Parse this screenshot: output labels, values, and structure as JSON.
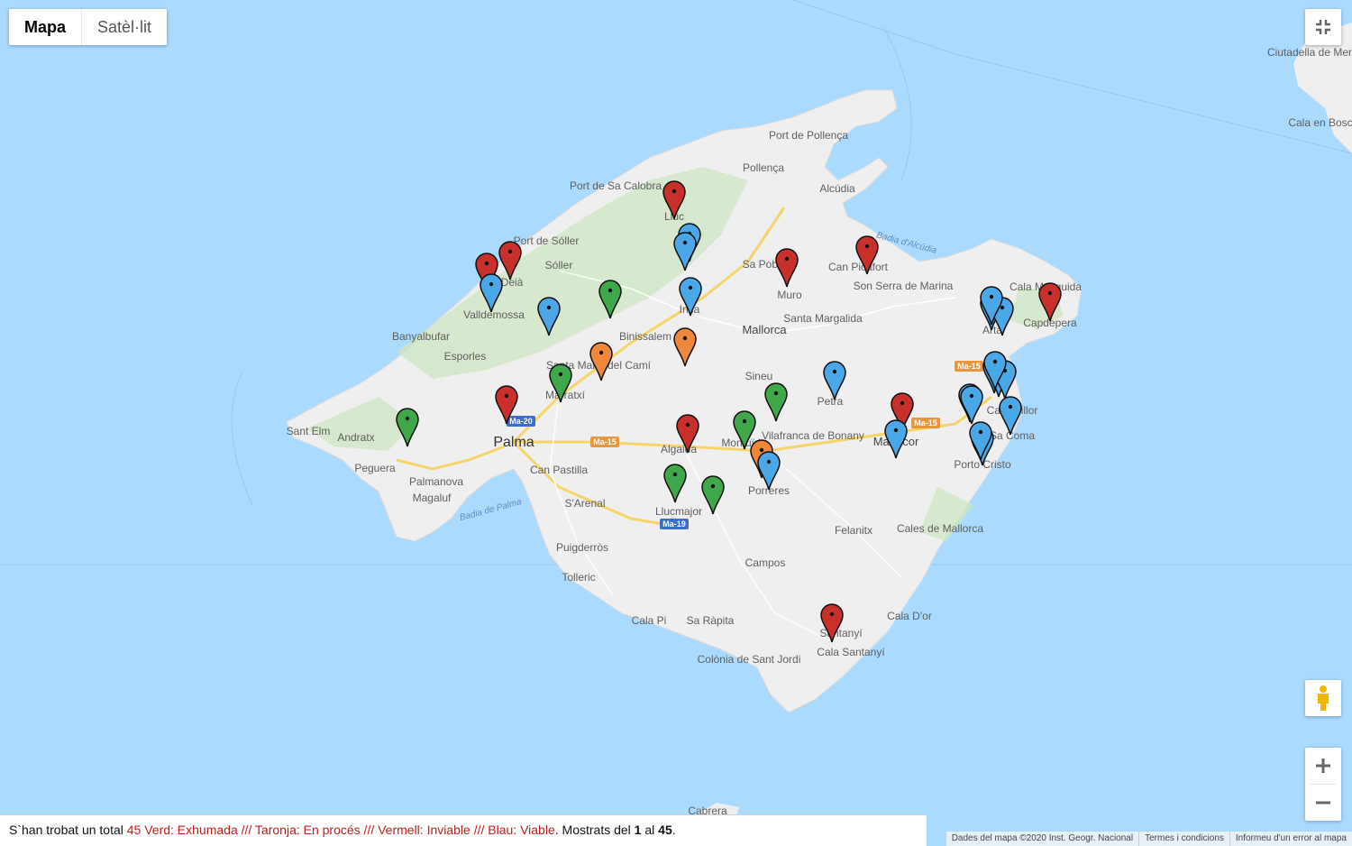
{
  "map_type": {
    "map_label": "Mapa",
    "satellite_label": "Satèl·lit"
  },
  "places": {
    "palma": "Palma",
    "mallorca": "Mallorca",
    "manacor": "Manacor",
    "port_de_pollenca": "Port de Pollença",
    "pollenca": "Pollença",
    "alcudia": "Alcúdia",
    "badia_alcudia": "Badia d'Alcúdia",
    "port_de_sa_calobra": "Port de Sa Calobra",
    "lluc": "Lluc",
    "port_de_soller": "Port de Sóller",
    "soller": "Sóller",
    "deia": "Deià",
    "valldemossa": "Valldemossa",
    "banyalbufar": "Banyalbufar",
    "esporles": "Esporles",
    "sant_elm": "Sant Elm",
    "andratx": "Andratx",
    "peguera": "Peguera",
    "palmanova": "Palmanova",
    "magaluf": "Magaluf",
    "badia_palma": "Badia de Palma",
    "can_pastilla": "Can Pastilla",
    "sarenal": "S'Arenal",
    "puigderros": "Puigderròs",
    "tolleric": "Tolleric",
    "cala_pi": "Cala Pi",
    "sa_rapita": "Sa Ràpita",
    "colonia_sant_jordi": "Colònia de Sant Jordi",
    "santanyi": "Santanyí",
    "cala_santanyi": "Cala Santanyí",
    "cala_dor": "Cala D'or",
    "felanitx": "Felanitx",
    "campos": "Campos",
    "llucmajor": "Llucmajor",
    "algaida": "Algaida",
    "montuiri": "Montuïri",
    "porreres": "Porreres",
    "vilafranca": "Vilafranca de Bonany",
    "petra": "Petra",
    "sineu": "Sineu",
    "santa_margalida": "Santa Margalida",
    "muro": "Muro",
    "sa_pobla": "Sa Pobla",
    "can_picafort": "Can Picafort",
    "son_serra": "Son Serra de Marina",
    "inca": "Inca",
    "binissalem": "Binissalem",
    "santa_maria": "Santa Maria del Camí",
    "marratxi": "Marratxí",
    "arta": "Artà",
    "capdepera": "Capdepera",
    "cala_mesquida": "Cala Mesquida",
    "cala_millor": "Cala Millor",
    "sa_coma": "Sa Coma",
    "porto_cristo": "Porto Cristo",
    "cales_de_mallorca": "Cales de Mallorca",
    "cabrera": "Cabrera",
    "ciutadella": "Ciutadella de Menorca",
    "cala_en_bosc": "Cala en Bosc"
  },
  "roads": {
    "ma20": "Ma-20",
    "ma15a": "Ma-15",
    "ma15b": "Ma-15",
    "ma15c": "Ma-15",
    "ma19": "Ma-19"
  },
  "marker_colors": {
    "green": "#3fa84a",
    "orange": "#f0883b",
    "red": "#c9302c",
    "blue": "#4aa8e8"
  },
  "markers": [
    {
      "status": "red"
    },
    {
      "status": "blue"
    },
    {
      "status": "blue"
    },
    {
      "status": "red"
    },
    {
      "status": "red"
    },
    {
      "status": "blue"
    },
    {
      "status": "blue"
    },
    {
      "status": "green"
    },
    {
      "status": "blue"
    },
    {
      "status": "red"
    },
    {
      "status": "red"
    },
    {
      "status": "orange"
    },
    {
      "status": "orange"
    },
    {
      "status": "green"
    },
    {
      "status": "red"
    },
    {
      "status": "green"
    },
    {
      "status": "red"
    },
    {
      "status": "green"
    },
    {
      "status": "green"
    },
    {
      "status": "blue"
    },
    {
      "status": "red"
    },
    {
      "status": "blue"
    },
    {
      "status": "green"
    },
    {
      "status": "green"
    },
    {
      "status": "orange"
    },
    {
      "status": "blue"
    },
    {
      "status": "red"
    },
    {
      "status": "blue"
    },
    {
      "status": "blue"
    },
    {
      "status": "red"
    },
    {
      "status": "blue"
    },
    {
      "status": "blue"
    },
    {
      "status": "blue"
    },
    {
      "status": "blue"
    },
    {
      "status": "blue"
    },
    {
      "status": "blue"
    },
    {
      "status": "blue"
    },
    {
      "status": "blue"
    },
    {
      "status": "blue"
    },
    {
      "status": "blue"
    }
  ],
  "footer": {
    "prefix": "S`han trobat un total ",
    "highlight": "45 Verd: Exhumada /// Taronja: En procés /// Vermell: Inviable /// Blau: Viable",
    "middle": ". Mostrats del ",
    "from": "1",
    "al": " al ",
    "to": "45",
    "end": "."
  },
  "attribution": {
    "data": "Dades del mapa ©2020 Inst. Geogr. Nacional",
    "terms": "Termes i condicions",
    "report": "Informeu d'un error al mapa"
  }
}
